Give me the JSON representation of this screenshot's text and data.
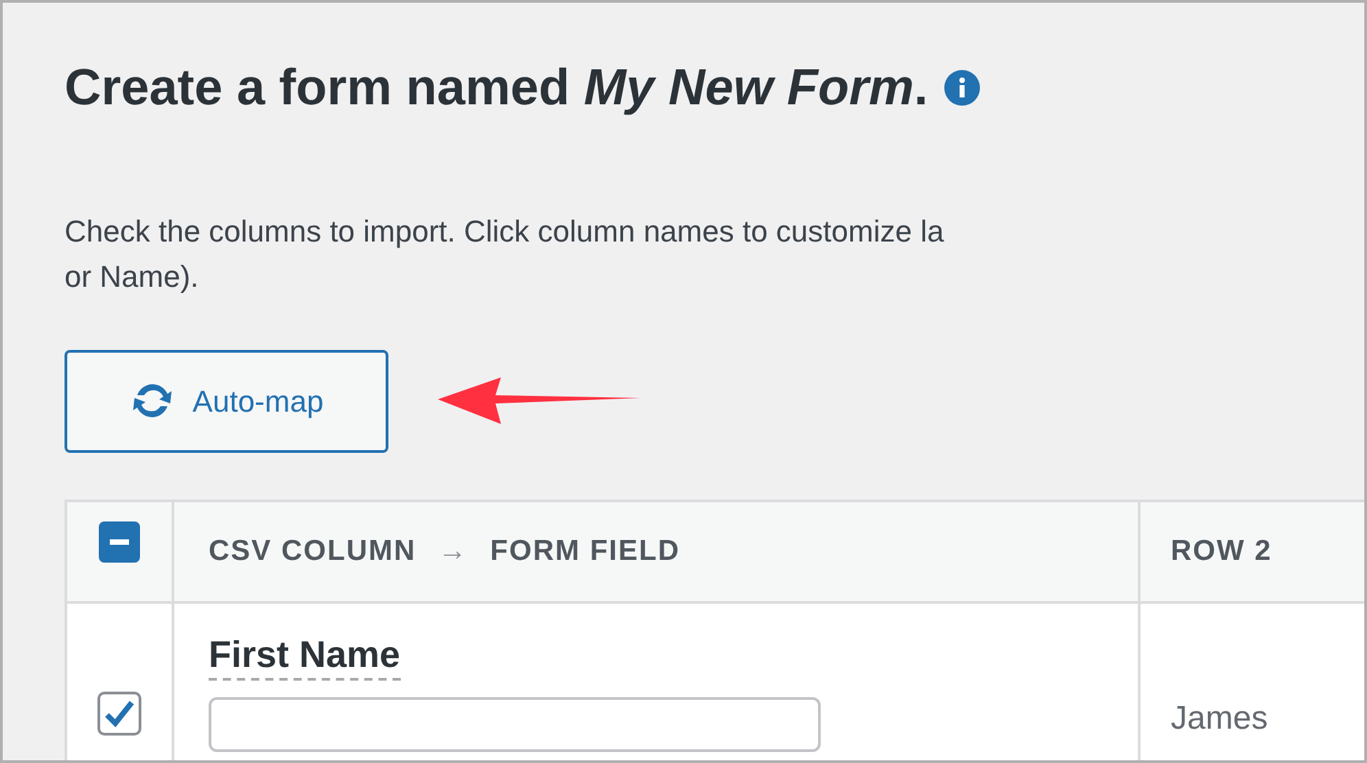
{
  "heading": "Create a form named *My New Form*.",
  "instructions": [
    "Check the columns to import. Click column names to customize la",
    "or Name)."
  ],
  "automap_button": {
    "label": "Auto-map"
  },
  "table": {
    "select_all": {
      "partial": true
    },
    "columns": [
      {
        "label": "CSV COLUMN",
        "arrow": "→",
        "label_2": "FORM FIELD"
      },
      {
        "label": "ROW 2"
      }
    ],
    "rows": [
      {
        "checked": true,
        "field_label": "First Name",
        "row_2": "James"
      }
    ]
  }
}
